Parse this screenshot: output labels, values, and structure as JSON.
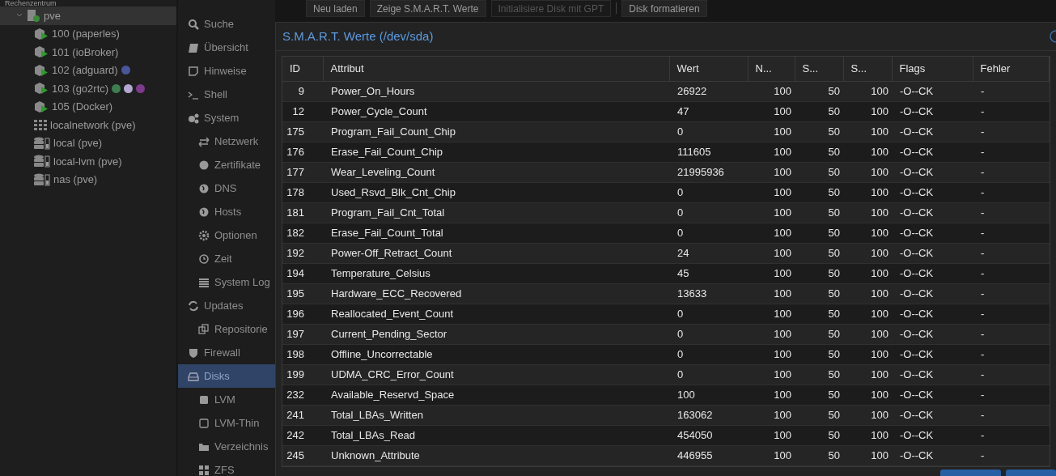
{
  "tree": [
    {
      "label": "Rechenzentrum",
      "children": [
        {
          "label": "pve",
          "kind": "node",
          "expanded": true,
          "selected": true,
          "children": [
            {
              "label": "100 (paperles)",
              "kind": "lxc",
              "selected": false
            },
            {
              "label": "101 (ioBroker)",
              "kind": "lxc",
              "selected": false
            },
            {
              "label": "102 (adguard)",
              "kind": "lxc",
              "selected": false,
              "tags": [
                {
                  "color": "#4a5699"
                }
              ]
            },
            {
              "label": "103 (go2rtc)",
              "kind": "lxc",
              "selected": false,
              "tags": [
                {
                  "color": "#3e7d4f"
                },
                {
                  "color": "#b3a7cf"
                },
                {
                  "color": "#7e3a8c"
                }
              ]
            },
            {
              "label": "105 (Docker)",
              "kind": "lxc",
              "selected": false
            },
            {
              "label": "localnetwork (pve)",
              "kind": "sdn",
              "selected": false
            },
            {
              "label": "local (pve)",
              "kind": "storage",
              "selected": false
            },
            {
              "label": "local-lvm (pve)",
              "kind": "storage",
              "selected": false
            },
            {
              "label": "nas (pve)",
              "kind": "storage",
              "selected": false
            }
          ]
        }
      ]
    }
  ],
  "nav": [
    {
      "label": "Suche",
      "selected": false
    },
    {
      "label": "Übersicht",
      "selected": false
    },
    {
      "label": "Hinweise",
      "selected": false
    },
    {
      "label": "Shell",
      "selected": false
    },
    {
      "label": "System",
      "selected": false,
      "children": [
        {
          "label": "Netzwerk",
          "selected": false
        },
        {
          "label": "Zertifikate",
          "selected": false
        },
        {
          "label": "DNS",
          "selected": false
        },
        {
          "label": "Hosts",
          "selected": false
        },
        {
          "label": "Optionen",
          "selected": false
        },
        {
          "label": "Zeit",
          "selected": false
        },
        {
          "label": "System Log",
          "selected": false
        }
      ]
    },
    {
      "label": "Updates",
      "selected": false,
      "children": [
        {
          "label": "Repositorie",
          "selected": false
        }
      ]
    },
    {
      "label": "Firewall",
      "selected": false
    },
    {
      "label": "Disks",
      "selected": true,
      "children": [
        {
          "label": "LVM",
          "selected": false
        },
        {
          "label": "LVM-Thin",
          "selected": false
        },
        {
          "label": "Verzeichnis",
          "selected": false
        },
        {
          "label": "ZFS",
          "selected": false
        }
      ]
    }
  ],
  "toolbar": [
    {
      "label": "Neu laden",
      "disabled": false
    },
    {
      "label": "Zeige S.M.A.R.T. Werte",
      "disabled": false
    },
    {
      "label": "Initialisiere Disk mit GPT",
      "disabled": true
    },
    {
      "label": "Disk formatieren",
      "disabled": false
    }
  ],
  "dialog": {
    "title": "S.M.A.R.T. Werte (/dev/sda)",
    "table": {
      "columns": [
        "ID",
        "Attribut",
        "Wert",
        "N...",
        "S...",
        "S...",
        "Flags",
        "Fehler"
      ],
      "rows": [
        [
          "9",
          "Power_On_Hours",
          "26922",
          "100",
          "50",
          "100",
          "-O--CK",
          "-"
        ],
        [
          "12",
          "Power_Cycle_Count",
          "47",
          "100",
          "50",
          "100",
          "-O--CK",
          "-"
        ],
        [
          "175",
          "Program_Fail_Count_Chip",
          "0",
          "100",
          "50",
          "100",
          "-O--CK",
          "-"
        ],
        [
          "176",
          "Erase_Fail_Count_Chip",
          "111605",
          "100",
          "50",
          "100",
          "-O--CK",
          "-"
        ],
        [
          "177",
          "Wear_Leveling_Count",
          "21995936",
          "100",
          "50",
          "100",
          "-O--CK",
          "-"
        ],
        [
          "178",
          "Used_Rsvd_Blk_Cnt_Chip",
          "0",
          "100",
          "50",
          "100",
          "-O--CK",
          "-"
        ],
        [
          "181",
          "Program_Fail_Cnt_Total",
          "0",
          "100",
          "50",
          "100",
          "-O--CK",
          "-"
        ],
        [
          "182",
          "Erase_Fail_Count_Total",
          "0",
          "100",
          "50",
          "100",
          "-O--CK",
          "-"
        ],
        [
          "192",
          "Power-Off_Retract_Count",
          "24",
          "100",
          "50",
          "100",
          "-O--CK",
          "-"
        ],
        [
          "194",
          "Temperature_Celsius",
          "45",
          "100",
          "50",
          "100",
          "-O--CK",
          "-"
        ],
        [
          "195",
          "Hardware_ECC_Recovered",
          "13633",
          "100",
          "50",
          "100",
          "-O--CK",
          "-"
        ],
        [
          "196",
          "Reallocated_Event_Count",
          "0",
          "100",
          "50",
          "100",
          "-O--CK",
          "-"
        ],
        [
          "197",
          "Current_Pending_Sector",
          "0",
          "100",
          "50",
          "100",
          "-O--CK",
          "-"
        ],
        [
          "198",
          "Offline_Uncorrectable",
          "0",
          "100",
          "50",
          "100",
          "-O--CK",
          "-"
        ],
        [
          "199",
          "UDMA_CRC_Error_Count",
          "0",
          "100",
          "50",
          "100",
          "-O--CK",
          "-"
        ],
        [
          "232",
          "Available_Reservd_Space",
          "100",
          "100",
          "50",
          "100",
          "-O--CK",
          "-"
        ],
        [
          "241",
          "Total_LBAs_Written",
          "163062",
          "100",
          "50",
          "100",
          "-O--CK",
          "-"
        ],
        [
          "242",
          "Total_LBAs_Read",
          "454050",
          "100",
          "50",
          "100",
          "-O--CK",
          "-"
        ],
        [
          "245",
          "Unknown_Attribute",
          "446955",
          "100",
          "50",
          "100",
          "-O--CK",
          "-"
        ]
      ]
    }
  }
}
